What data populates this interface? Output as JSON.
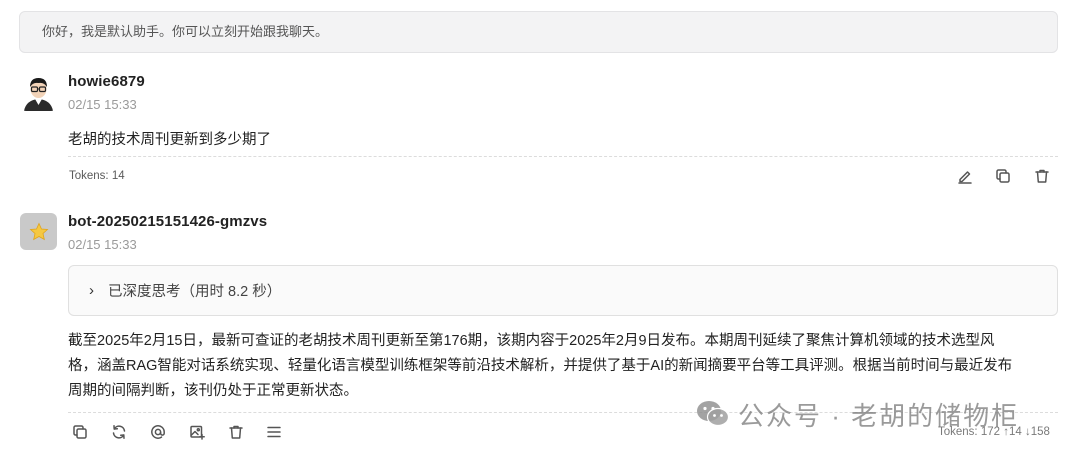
{
  "welcome": {
    "text": "你好，我是默认助手。你可以立刻开始跟我聊天。"
  },
  "user_message": {
    "author": "howie6879",
    "time": "02/15 15:33",
    "text": "老胡的技术周刊更新到多少期了",
    "tokens": "Tokens: 14",
    "actions": {
      "edit_icon": "pencil-icon",
      "copy_icon": "copy-icon",
      "delete_icon": "trash-icon"
    }
  },
  "bot_message": {
    "author": "bot-20250215151426-gmzvs",
    "time": "02/15 15:33",
    "thinking": {
      "chevron": "›",
      "label": "已深度思考（用时 8.2 秒）"
    },
    "answer_lines": [
      "截至2025年2月15日，最新可查证的老胡技术周刊更新至第176期，该期内容于2025年2月9日发布。本期周刊延续了聚焦计算机领域的技术选型风",
      "格，涵盖RAG智能对话系统实现、轻量化语言模型训练框架等前沿技术解析，并提供了基于AI的新闻摘要平台等工具评测。根据当前时间与最近发布",
      "周期的间隔判断，该刊仍处于正常更新状态。"
    ],
    "tokens": "Tokens: 172 ↑14 ↓158",
    "actions": [
      "copy-icon",
      "refresh-icon",
      "at-icon",
      "image-icon",
      "trash-icon",
      "menu-icon"
    ]
  },
  "watermark": {
    "text": "公众号 · 老胡的储物柜",
    "icon": "wechat-icon"
  }
}
